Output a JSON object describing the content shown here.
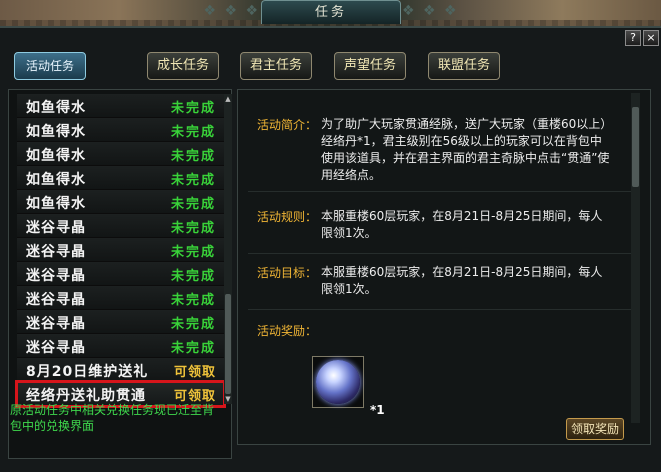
{
  "window": {
    "title": "任务",
    "help_label": "?",
    "close_label": "×"
  },
  "tabs": [
    {
      "label": "活动任务",
      "active": true
    },
    {
      "label": "成长任务",
      "active": false
    },
    {
      "label": "君主任务",
      "active": false
    },
    {
      "label": "声望任务",
      "active": false
    },
    {
      "label": "联盟任务",
      "active": false
    }
  ],
  "quest_list": [
    {
      "name": "如鱼得水",
      "status": "未完成"
    },
    {
      "name": "如鱼得水",
      "status": "未完成"
    },
    {
      "name": "如鱼得水",
      "status": "未完成"
    },
    {
      "name": "如鱼得水",
      "status": "未完成"
    },
    {
      "name": "如鱼得水",
      "status": "未完成"
    },
    {
      "name": "迷谷寻晶",
      "status": "未完成"
    },
    {
      "name": "迷谷寻晶",
      "status": "未完成"
    },
    {
      "name": "迷谷寻晶",
      "status": "未完成"
    },
    {
      "name": "迷谷寻晶",
      "status": "未完成"
    },
    {
      "name": "迷谷寻晶",
      "status": "未完成"
    },
    {
      "name": "迷谷寻晶",
      "status": "未完成"
    },
    {
      "name": "8月20日维护送礼",
      "status": "可领取"
    },
    {
      "name": "经络丹送礼助贯通",
      "status": "可领取"
    }
  ],
  "note": "原活动任务中相关兑换任务现已迁至背包中的兑换界面",
  "detail": {
    "intro_label": "活动简介：",
    "intro_text": "为了助广大玩家贯通经脉，送广大玩家（重楼60以上）经络丹*1，君主级别在56级以上的玩家可以在背包中使用该道具，并在君主界面的君主奇脉中点击“贯通”使用经络点。",
    "rule_label": "活动规则：",
    "rule_text": "本服重楼60层玩家，在8月21日-8月25日期间，每人限领1次。",
    "goal_label": "活动目标：",
    "goal_text": "本服重楼60层玩家，在8月21日-8月25日期间，每人限领1次。",
    "reward_label": "活动奖励：",
    "reward_qty": "*1",
    "claim_button": "领取奖励"
  },
  "colors": {
    "incomplete": "#39d339",
    "claimable": "#f0c33a",
    "label": "#f0b535",
    "highlight": "#d6151b",
    "note": "#3fd94d"
  }
}
